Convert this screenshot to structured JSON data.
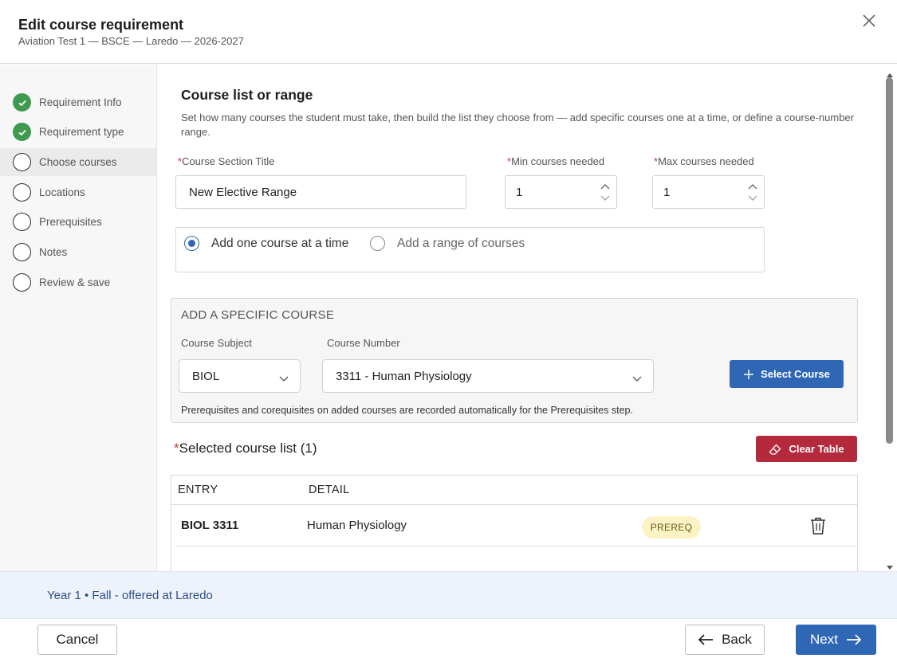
{
  "header": {
    "title": "Edit course requirement",
    "subtitle": "Aviation Test 1 — BSCE — Laredo — 2026-2027"
  },
  "steps": [
    {
      "label": "Requirement Info",
      "state": "done"
    },
    {
      "label": "Requirement type",
      "state": "done"
    },
    {
      "label": "Choose courses",
      "state": "active"
    },
    {
      "label": "Locations",
      "state": "pending"
    },
    {
      "label": "Prerequisites",
      "state": "pending"
    },
    {
      "label": "Notes",
      "state": "pending"
    },
    {
      "label": "Review & save",
      "state": "pending"
    }
  ],
  "main": {
    "title": "Course list or range",
    "description": "Set how many courses the student must take, then build the list they choose from — add specific courses one at a time, or define a course-number range.",
    "required_mark": "*",
    "section_title_label": "Course Section Title",
    "section_title_value": "New Elective Range",
    "min_label": "Min courses needed",
    "min_value": "1",
    "max_label": "Max courses needed",
    "max_value": "1",
    "radio_one": "Add one course at a time",
    "radio_range": "Add a range of courses",
    "selected_mode": "one"
  },
  "add_course": {
    "title": "ADD A SPECIFIC COURSE",
    "subject_label": "Course Subject",
    "subject_value": "BIOL",
    "number_label": "Course Number",
    "number_value": "3311 - Human Physiology",
    "select_button": "Select Course",
    "note": "Prerequisites and corequisites on added courses are recorded automatically for the Prerequisites step."
  },
  "course_list": {
    "title": "Selected course list (1)",
    "clear_button": "Clear Table",
    "columns": [
      "ENTRY",
      "DETAIL"
    ],
    "rows": [
      {
        "entry": "BIOL 3311",
        "detail": "Human Physiology",
        "badge": "PREREQ"
      }
    ]
  },
  "info_strip": {
    "text": "Year 1 • Fall - offered at Laredo"
  },
  "footer": {
    "cancel": "Cancel",
    "back": "Back",
    "next": "Next"
  },
  "colors": {
    "primary": "#2f67b5",
    "danger": "#b5293d",
    "success": "#3e9a4e",
    "badge_bg": "#fbf3c3",
    "info_bg": "#eef3fb"
  },
  "icons": [
    "close-icon",
    "check-icon",
    "chevron-down-icon",
    "plus-icon",
    "eraser-icon",
    "trash-icon",
    "arrow-left-icon",
    "arrow-right-icon",
    "spinner-up-icon",
    "spinner-down-icon"
  ]
}
